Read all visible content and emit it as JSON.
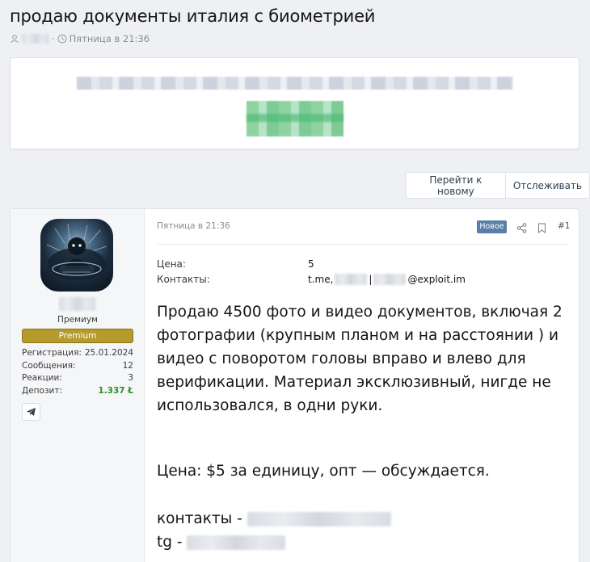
{
  "thread": {
    "title": "продаю документы италия с биометрией",
    "date": "Пятница в 21:36"
  },
  "actions": {
    "go_new": "Перейти к новому",
    "watch": "Отслеживать"
  },
  "author": {
    "user_title": "Премиум",
    "banner": "Premium",
    "stats": [
      {
        "label": "Регистрация:",
        "value": "25.01.2024"
      },
      {
        "label": "Сообщения:",
        "value": "12"
      },
      {
        "label": "Реакции:",
        "value": "3"
      },
      {
        "label": "Депозит:",
        "value": "1.337 Ł"
      }
    ]
  },
  "post": {
    "date": "Пятница в 21:36",
    "new_badge": "Новое",
    "number": "#1",
    "fields": [
      {
        "label": "Цена:",
        "value": "5"
      },
      {
        "label": "Контакты:",
        "value_prefix": "t.me,",
        "value_sep": "|",
        "value_suffix": "@exploit.im"
      }
    ],
    "body": "Продаю 4500 фото и видео документов, включая 2 фотографии (крупным планом и на расстоянии ) и видео с поворотом головы вправо и влево для верификации. Материал эксклюзивный, нигде не использовался, в одни руки.",
    "price_line": "Цена: $5 за единицу, опт — обсуждается.",
    "contacts_label": "контакты -",
    "tg_label": "tg -"
  },
  "colors": {
    "premium_banner": "#b59a2c",
    "new_badge": "#5a7ea8",
    "deposit": "#2e8b2e"
  }
}
